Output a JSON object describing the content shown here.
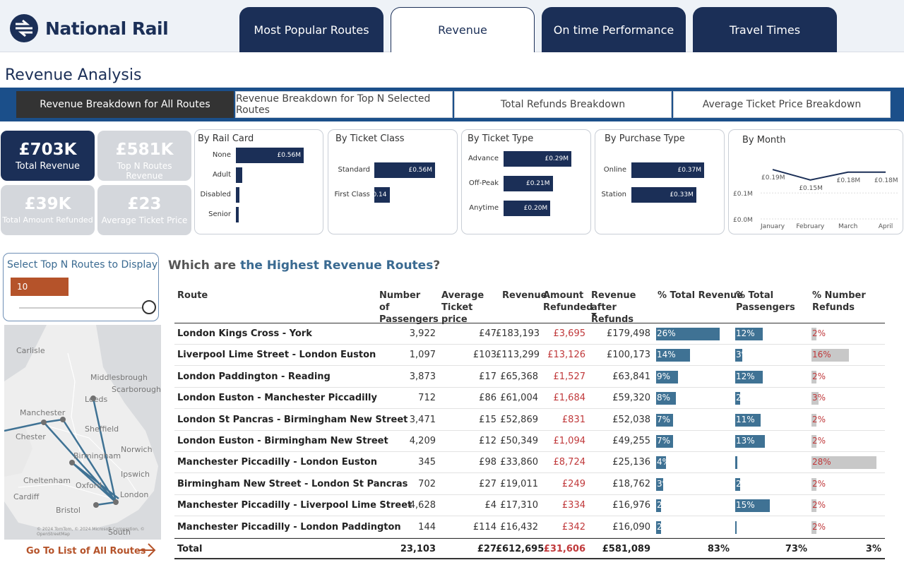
{
  "brand": {
    "name": "National Rail",
    "colors": {
      "navy": "#1b2f57",
      "accent": "#b5532a",
      "teal": "#3f7294"
    }
  },
  "nav_tabs": [
    {
      "label": "Most Popular Routes"
    },
    {
      "label": "Revenue"
    },
    {
      "label": "On time Performance"
    },
    {
      "label": "Travel Times"
    }
  ],
  "page_title": "Revenue Analysis",
  "sub_tabs": [
    {
      "label": "Revenue Breakdown for All Routes"
    },
    {
      "label": "Revenue Breakdown for Top N Selected Routes"
    },
    {
      "label": "Total Refunds Breakdown"
    },
    {
      "label": "Average Ticket Price Breakdown"
    }
  ],
  "kpis": [
    {
      "value": "£703K",
      "label": "Total Revenue"
    },
    {
      "value": "£581K",
      "label": "Top N Routes Revenue"
    },
    {
      "value": "£39K",
      "label": "Total Amount Refunded"
    },
    {
      "value": "£23",
      "label": "Average Ticket Price"
    }
  ],
  "cards": {
    "rail_card": {
      "title": "By Rail Card",
      "rows": [
        {
          "label": "None",
          "value": 0.56,
          "text": "£0.56M"
        },
        {
          "label": "Adult",
          "value": 0.05,
          "text": ""
        },
        {
          "label": "Disabled",
          "value": 0.03,
          "text": ""
        },
        {
          "label": "Senior",
          "value": 0.02,
          "text": ""
        }
      ]
    },
    "ticket_class": {
      "title": "By Ticket Class",
      "rows": [
        {
          "label": "Standard",
          "value": 0.56,
          "text": "£0.56M"
        },
        {
          "label": "First Class",
          "value": 0.14,
          "text": "£0.14"
        }
      ]
    },
    "ticket_type": {
      "title": "By Ticket Type",
      "rows": [
        {
          "label": "Advance",
          "value": 0.29,
          "text": "£0.29M"
        },
        {
          "label": "Off-Peak",
          "value": 0.21,
          "text": "£0.21M"
        },
        {
          "label": "Anytime",
          "value": 0.2,
          "text": "£0.20M"
        }
      ]
    },
    "purchase_type": {
      "title": "By Purchase Type",
      "rows": [
        {
          "label": "Online",
          "value": 0.37,
          "text": "£0.37M"
        },
        {
          "label": "Station",
          "value": 0.33,
          "text": "£0.33M"
        }
      ]
    },
    "month": {
      "title": "By Month",
      "points": [
        {
          "month": "January",
          "value": 0.19,
          "label": "£0.19M"
        },
        {
          "month": "February",
          "value": 0.15,
          "label": "£0.15M"
        },
        {
          "month": "March",
          "value": 0.18,
          "label": "£0.18M"
        },
        {
          "month": "April",
          "value": 0.18,
          "label": "£0.18M"
        }
      ],
      "y_ticks": [
        "£0.1M",
        "£0.0M"
      ]
    }
  },
  "selector": {
    "title": "Select Top N Routes to Display",
    "value": "10"
  },
  "map": {
    "labels": [
      "Carlisle",
      "Middlesbrough",
      "Scarborough",
      "Leeds",
      "Manchester",
      "Chester",
      "Sheffield",
      "Norwich",
      "Birmingham",
      "Ipswich",
      "Cheltenham",
      "Oxford",
      "London",
      "Cardiff",
      "Bristol",
      "South"
    ],
    "attribution": "© 2024 TomTom, © 2024 Microsoft Corporation, © OpenStreetMap"
  },
  "go_link": "Go To List of All Routes",
  "table": {
    "title_prefix": "Which are ",
    "title_highlight": "the Highest Revenue Routes",
    "title_suffix": "?",
    "headers": [
      "Route",
      "Number of Passengers",
      "Average Ticket price",
      "Revenue",
      "Amount Refunded",
      "Revenue after Refunds",
      "% Total Revenue",
      "% Total Passengers",
      "% Number Refunds"
    ],
    "rows": [
      {
        "route": "London Kings Cross - York",
        "passengers": "3,922",
        "avg_price": "£47",
        "revenue": "£183,193",
        "refunded": "£3,695",
        "after": "£179,498",
        "pct_rev": 26,
        "pct_rev_label": "26%",
        "pct_pass": 12,
        "pct_pass_label": "12%",
        "pct_ref": 2,
        "pct_ref_label": "2%"
      },
      {
        "route": "Liverpool Lime Street - London Euston",
        "passengers": "1,097",
        "avg_price": "£103",
        "revenue": "£113,299",
        "refunded": "£13,126",
        "after": "£100,173",
        "pct_rev": 14,
        "pct_rev_label": "14%",
        "pct_pass": 3,
        "pct_pass_label": "3%",
        "pct_ref": 16,
        "pct_ref_label": "16%"
      },
      {
        "route": "London Paddington - Reading",
        "passengers": "3,873",
        "avg_price": "£17",
        "revenue": "£65,368",
        "refunded": "£1,527",
        "after": "£63,841",
        "pct_rev": 9,
        "pct_rev_label": "9%",
        "pct_pass": 12,
        "pct_pass_label": "12%",
        "pct_ref": 2,
        "pct_ref_label": "2%"
      },
      {
        "route": "London Euston - Manchester Piccadilly",
        "passengers": "712",
        "avg_price": "£86",
        "revenue": "£61,004",
        "refunded": "£1,684",
        "after": "£59,320",
        "pct_rev": 8,
        "pct_rev_label": "8%",
        "pct_pass": 2,
        "pct_pass_label": "2%",
        "pct_ref": 3,
        "pct_ref_label": "3%"
      },
      {
        "route": "London St Pancras - Birmingham New Street",
        "passengers": "3,471",
        "avg_price": "£15",
        "revenue": "£52,869",
        "refunded": "£831",
        "after": "£52,038",
        "pct_rev": 7,
        "pct_rev_label": "7%",
        "pct_pass": 11,
        "pct_pass_label": "11%",
        "pct_ref": 2,
        "pct_ref_label": "2%"
      },
      {
        "route": "London Euston - Birmingham New Street",
        "passengers": "4,209",
        "avg_price": "£12",
        "revenue": "£50,349",
        "refunded": "£1,094",
        "after": "£49,255",
        "pct_rev": 7,
        "pct_rev_label": "7%",
        "pct_pass": 13,
        "pct_pass_label": "13%",
        "pct_ref": 2,
        "pct_ref_label": "2%"
      },
      {
        "route": "Manchester Piccadilly - London Euston",
        "passengers": "345",
        "avg_price": "£98",
        "revenue": "£33,860",
        "refunded": "£8,724",
        "after": "£25,136",
        "pct_rev": 4,
        "pct_rev_label": "4%",
        "pct_pass": 1,
        "pct_pass_label": "",
        "pct_ref": 28,
        "pct_ref_label": "28%"
      },
      {
        "route": "Birmingham New Street - London St Pancras",
        "passengers": "702",
        "avg_price": "£27",
        "revenue": "£19,011",
        "refunded": "£249",
        "after": "£18,762",
        "pct_rev": 3,
        "pct_rev_label": "3%",
        "pct_pass": 2,
        "pct_pass_label": "2%",
        "pct_ref": 2,
        "pct_ref_label": "2%"
      },
      {
        "route": "Manchester Piccadilly - Liverpool Lime Street",
        "passengers": "4,628",
        "avg_price": "£4",
        "revenue": "£17,310",
        "refunded": "£334",
        "after": "£16,976",
        "pct_rev": 2,
        "pct_rev_label": "2%",
        "pct_pass": 15,
        "pct_pass_label": "15%",
        "pct_ref": 2,
        "pct_ref_label": "2%"
      },
      {
        "route": "Manchester Piccadilly - London Paddington",
        "passengers": "144",
        "avg_price": "£114",
        "revenue": "£16,432",
        "refunded": "£342",
        "after": "£16,090",
        "pct_rev": 2,
        "pct_rev_label": "2%",
        "pct_pass": 0.5,
        "pct_pass_label": "",
        "pct_ref": 2,
        "pct_ref_label": "2%"
      }
    ],
    "total": {
      "label": "Total",
      "passengers": "23,103",
      "avg_price": "£27",
      "revenue": "£612,695",
      "refunded": "£31,606",
      "after": "£581,089",
      "pct_rev": "83%",
      "pct_pass": "73%",
      "pct_ref": "3%"
    }
  }
}
